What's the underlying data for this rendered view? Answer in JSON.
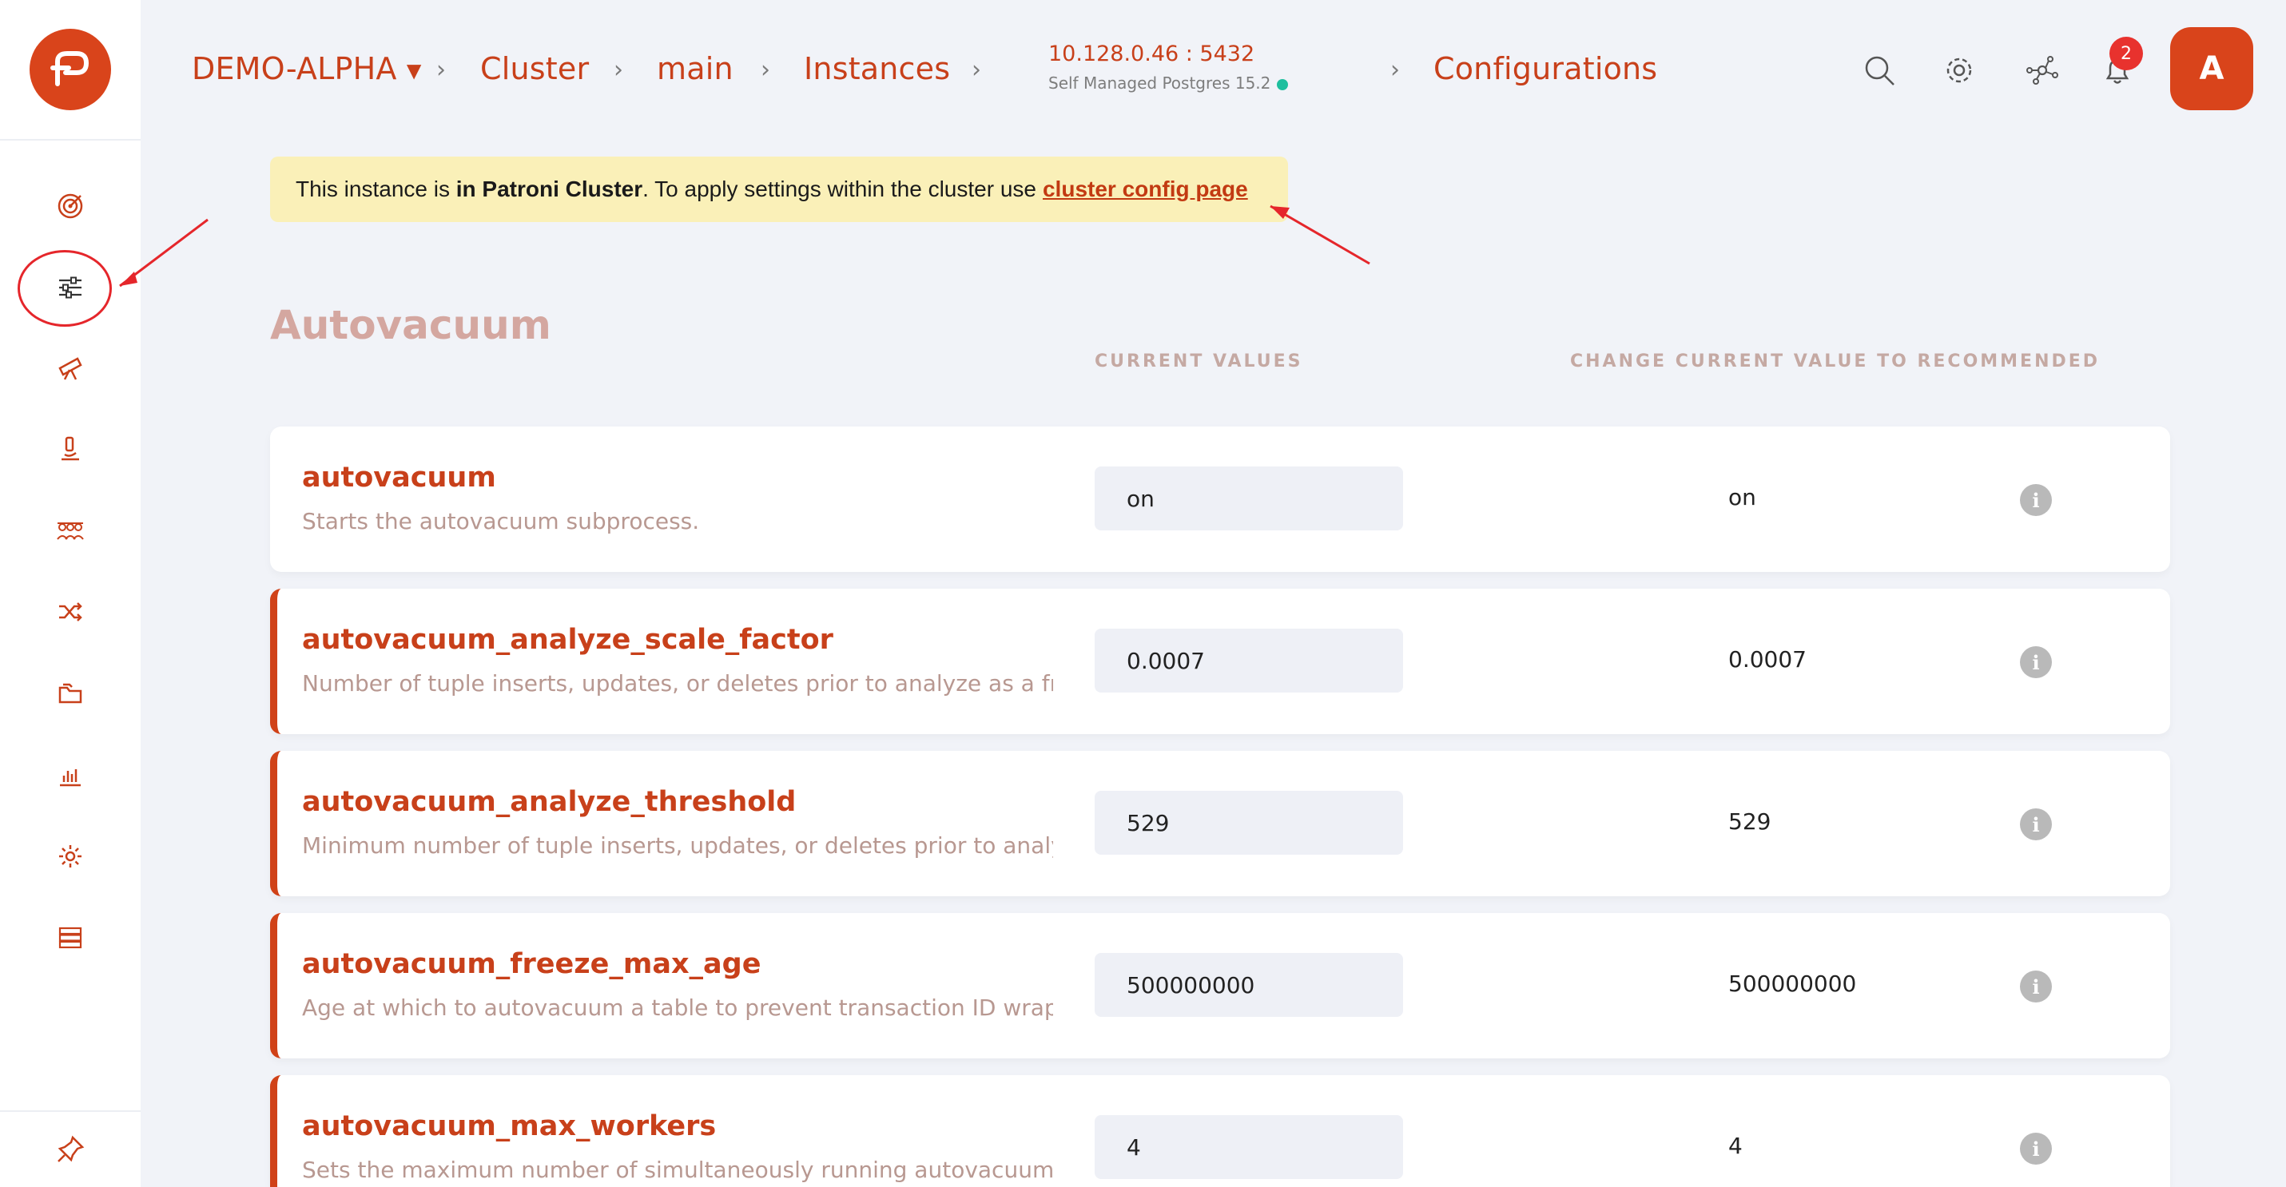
{
  "breadcrumb": {
    "org": "DEMO-ALPHA",
    "cluster": "Cluster",
    "main": "main",
    "instances": "Instances",
    "host": "10.128.0.46 : 5432",
    "host_sub": "Self Managed Postgres 15.2",
    "current": "Configurations"
  },
  "header": {
    "notification_count": "2",
    "avatar_initial": "A"
  },
  "notice": {
    "prefix": "This instance is ",
    "bold": "in Patroni Cluster",
    "middle": ". To apply settings within the cluster use",
    "link": "cluster config page"
  },
  "section": {
    "title": "Autovacuum",
    "col_current": "CURRENT VALUES",
    "col_recommended": "CHANGE CURRENT VALUE TO RECOMMENDED"
  },
  "settings": [
    {
      "name": "autovacuum",
      "desc": "Starts the autovacuum subprocess.",
      "current": "on",
      "recommended": "on",
      "changed": false
    },
    {
      "name": "autovacuum_analyze_scale_factor",
      "desc": "Number of tuple inserts, updates, or deletes prior to analyze as a fraction of reltuples.",
      "current": "0.0007",
      "recommended": "0.0007",
      "changed": true
    },
    {
      "name": "autovacuum_analyze_threshold",
      "desc": "Minimum number of tuple inserts, updates, or deletes prior to analyze.",
      "current": "529",
      "recommended": "529",
      "changed": true
    },
    {
      "name": "autovacuum_freeze_max_age",
      "desc": "Age at which to autovacuum a table to prevent transaction ID wraparound.",
      "current": "500000000",
      "recommended": "500000000",
      "changed": true
    },
    {
      "name": "autovacuum_max_workers",
      "desc": "Sets the maximum number of simultaneously running autovacuum worker processes.",
      "current": "4",
      "recommended": "4",
      "changed": true
    }
  ],
  "icons": {
    "sidebar": [
      "dashboard-target-icon",
      "config-sliders-icon",
      "telescope-icon",
      "microscope-icon",
      "users-group-icon",
      "shuffle-icon",
      "folders-icon",
      "bar-chart-icon",
      "settings-gear-icon",
      "server-stack-icon"
    ],
    "pin": "pin-icon"
  },
  "colors": {
    "brand": "#d9441b",
    "notice_bg": "#faf0b8",
    "annotation": "#e5262b"
  },
  "info_glyph": "i"
}
